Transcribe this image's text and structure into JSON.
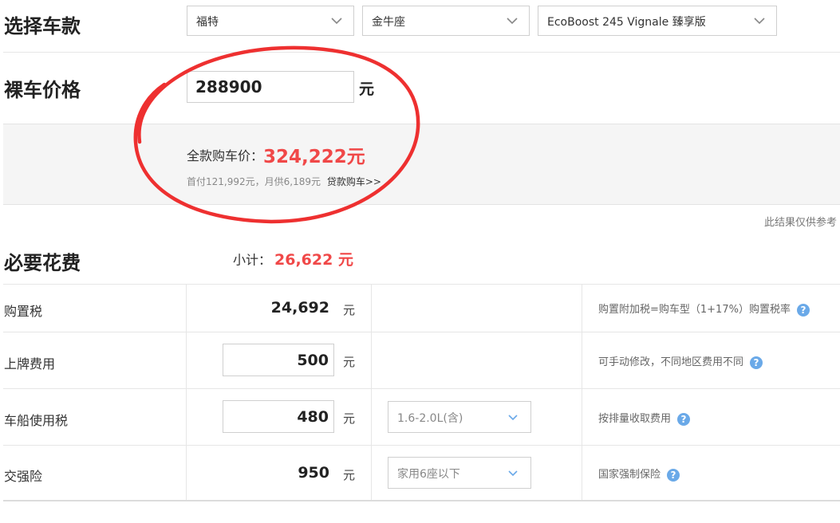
{
  "select_car": {
    "title": "选择车款",
    "brand": "福特",
    "series": "金牛座",
    "model": "EcoBoost 245 Vignale 臻享版"
  },
  "bare_price": {
    "title": "裸车价格",
    "value": "288900",
    "unit": "元"
  },
  "summary": {
    "total_label": "全款购车价：",
    "total_value": "324,222元",
    "loan_info": "首付121,992元，月供6,189元",
    "loan_link": "贷款购车>>"
  },
  "disclaimer": "此结果仅供参考",
  "required": {
    "title": "必要花费",
    "subtotal_label": "小计：",
    "subtotal_value": "26,622 元",
    "rows": [
      {
        "label": "购置税",
        "value": "24,692",
        "unit": "元",
        "note": "购置附加税=购车型（1+17%）购置税率"
      },
      {
        "label": "上牌费用",
        "value": "500",
        "unit": "元",
        "note": "可手动修改，不同地区费用不同"
      },
      {
        "label": "车船使用税",
        "value": "480",
        "unit": "元",
        "option": "1.6-2.0L(含)",
        "note": "按排量收取费用"
      },
      {
        "label": "交强险",
        "value": "950",
        "unit": "元",
        "option": "家用6座以下",
        "note": "国家强制保险"
      }
    ]
  },
  "colors": {
    "accent_red": "#f04848",
    "help_blue": "#6aa9e8",
    "annotation_circle": "#ee3030"
  },
  "icons": {
    "dropdown": "chevron-down-icon",
    "help": "question-circle-icon"
  }
}
